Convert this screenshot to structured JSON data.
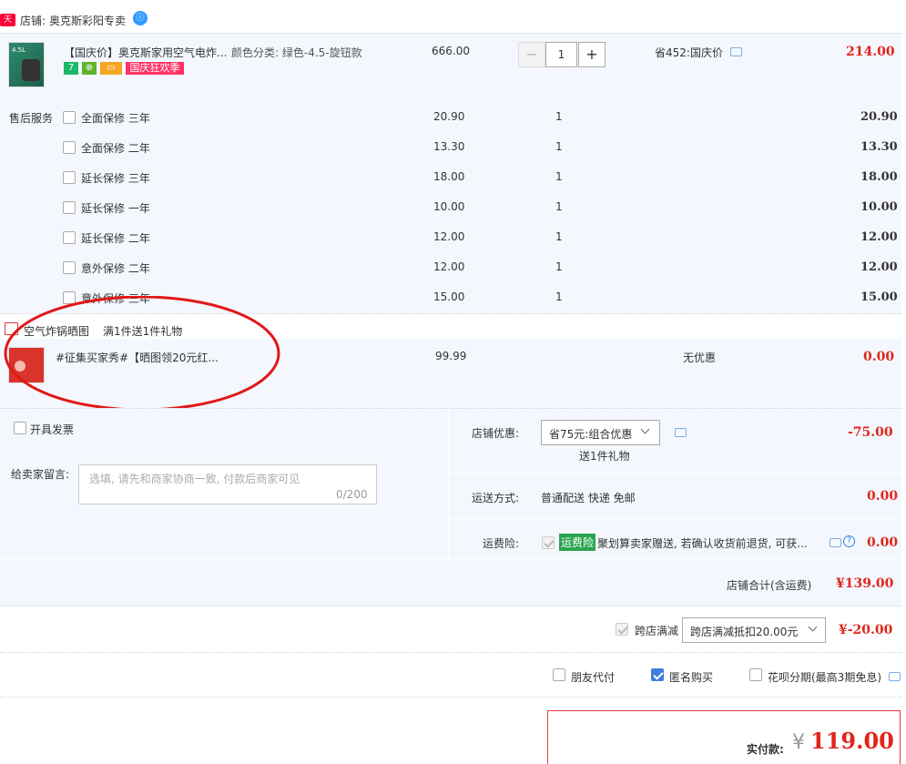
{
  "shop": {
    "badge": "天猫",
    "label": "店铺:",
    "name": "奥克斯彩阳专卖"
  },
  "product": {
    "thumb_text": "4.5L",
    "title": "【国庆价】奥克斯家用空气电炸...",
    "spec": "颜色分类: 绿色-4.5-旋钮款",
    "tag_seven": "7",
    "tag_festival": "国庆狂欢季",
    "price": "666.00",
    "qty": "1",
    "minus": "−",
    "plus": "+",
    "discount": "省452:国庆价",
    "total": "214.00"
  },
  "service": {
    "label": "售后服务",
    "items": [
      {
        "name": "全面保修 三年",
        "price": "20.90",
        "qty": "1",
        "total": "20.90"
      },
      {
        "name": "全面保修 二年",
        "price": "13.30",
        "qty": "1",
        "total": "13.30"
      },
      {
        "name": "延长保修 三年",
        "price": "18.00",
        "qty": "1",
        "total": "18.00"
      },
      {
        "name": "延长保修 一年",
        "price": "10.00",
        "qty": "1",
        "total": "10.00"
      },
      {
        "name": "延长保修 二年",
        "price": "12.00",
        "qty": "1",
        "total": "12.00"
      },
      {
        "name": "意外保修 二年",
        "price": "12.00",
        "qty": "1",
        "total": "12.00"
      },
      {
        "name": "意外保修 三年",
        "price": "15.00",
        "qty": "1",
        "total": "15.00"
      }
    ]
  },
  "gift": {
    "title": "空气炸锅晒图",
    "rule": "满1件送1件礼物",
    "item_title": "#征集买家秀#【晒图领20元红...",
    "price": "99.99",
    "discount": "无优惠",
    "total": "0.00"
  },
  "invoice": {
    "label": "开具发票"
  },
  "message": {
    "label": "给卖家留言:",
    "placeholder": "选填, 请先和商家协商一致, 付款后商家可见",
    "count": "0/200"
  },
  "shop_discount": {
    "label": "店铺优惠:",
    "selected": "省75元:组合优惠",
    "sub": "送1件礼物",
    "amount": "-75.00"
  },
  "shipping": {
    "label": "运送方式:",
    "value": "普通配送 快递 免邮",
    "amount": "0.00"
  },
  "insurance": {
    "label": "运费险:",
    "badge": "运费险",
    "text": "聚划算卖家赠送, 若确认收货前退货, 可获...",
    "amount": "0.00"
  },
  "shop_total": {
    "label": "店铺合计(含运费)",
    "amount": "¥139.00"
  },
  "cross_store": {
    "label": "跨店满减",
    "selected": "跨店满减抵扣20.00元",
    "amount": "¥-20.00"
  },
  "options": {
    "friend_pay": "朋友代付",
    "anonymous": "匿名购买",
    "huabei": "花呗分期(最高3期免息)"
  },
  "payment": {
    "label": "实付款:",
    "currency": "¥",
    "amount": "119.00"
  },
  "colors": {
    "accent_red": "#e1251b",
    "blue_bg": "#f4f8fe",
    "annotation_red": "#e01818",
    "check_blue": "#3d7fe0"
  }
}
